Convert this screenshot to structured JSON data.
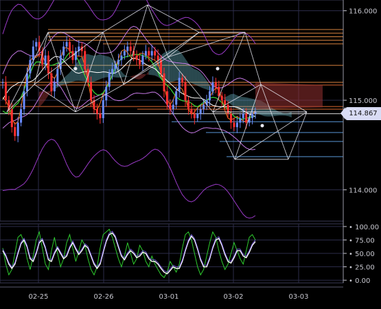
{
  "chart_data": [
    {
      "type": "candlestick",
      "title": "",
      "x_ticks": [
        "02-25",
        "02-26",
        "03-01",
        "03-02",
        "03-03"
      ],
      "y_ticks": [
        "116.000",
        "115.000",
        "114.000"
      ],
      "ylim": [
        113.65,
        116.12
      ],
      "current_price": "114.867",
      "grid": true,
      "overlays": [
        "bollinger-bands",
        "ichimoku-cloud",
        "moving-averages",
        "horizontal-levels",
        "geometric-pattern"
      ],
      "horizontal_levels": [
        115.79,
        115.75,
        115.71,
        115.67,
        115.63,
        115.39,
        115.2,
        115.17,
        114.93,
        114.9,
        114.85,
        114.76,
        114.64,
        114.54,
        114.37
      ],
      "close_series": [
        115.2,
        115.0,
        114.9,
        114.7,
        114.6,
        114.75,
        114.9,
        115.1,
        115.3,
        115.45,
        115.6,
        115.65,
        115.55,
        115.4,
        115.5,
        115.3,
        115.1,
        115.2,
        115.35,
        115.5,
        115.6,
        115.65,
        115.55,
        115.45,
        115.55,
        115.6,
        115.55,
        115.35,
        115.2,
        115.0,
        114.9,
        114.85,
        114.8,
        115.0,
        115.15,
        115.3,
        115.35,
        115.4,
        115.45,
        115.5,
        115.55,
        115.6,
        115.55,
        115.5,
        115.45,
        115.4,
        115.5,
        115.55,
        115.5,
        115.55,
        115.5,
        115.45,
        115.3,
        115.1,
        114.95,
        114.9,
        114.95,
        115.1,
        115.25,
        115.2,
        115.0,
        114.9,
        114.85,
        114.8,
        114.85,
        114.9,
        114.95,
        115.0,
        115.1,
        115.2,
        115.15,
        115.05,
        115.0,
        114.95,
        114.85,
        114.75,
        114.7,
        114.75,
        114.8,
        114.85,
        114.75,
        114.8,
        114.85,
        114.87
      ]
    },
    {
      "type": "line",
      "title": "",
      "y_ticks": [
        "100.00",
        "75.00",
        "50.00",
        "25.00",
        "0.00"
      ],
      "ylim": [
        -5,
        105
      ],
      "grid": true,
      "series": [
        {
          "values": [
            60,
            30,
            10,
            20,
            50,
            80,
            85,
            70,
            40,
            20,
            45,
            75,
            90,
            60,
            30,
            20,
            55,
            80,
            50,
            25,
            40,
            70,
            85,
            60,
            35,
            55,
            75,
            65,
            40,
            20,
            10,
            25,
            60,
            85,
            90,
            95,
            80,
            60,
            40,
            25,
            45,
            70,
            50,
            30,
            40,
            65,
            55,
            35,
            25,
            45,
            30,
            20,
            10,
            5,
            15,
            35,
            25,
            15,
            30,
            60,
            85,
            90,
            75,
            50,
            25,
            10,
            20,
            45,
            70,
            90,
            80,
            55,
            35,
            20,
            30,
            50,
            70,
            55,
            40,
            30,
            55,
            80,
            85,
            75
          ]
        },
        {
          "values": [
            55,
            45,
            30,
            22,
            30,
            50,
            68,
            75,
            62,
            40,
            35,
            50,
            70,
            75,
            60,
            38,
            35,
            50,
            60,
            50,
            40,
            45,
            60,
            70,
            58,
            48,
            55,
            65,
            60,
            45,
            30,
            22,
            30,
            52,
            72,
            85,
            88,
            80,
            62,
            45,
            38,
            48,
            55,
            50,
            42,
            45,
            52,
            50,
            40,
            35,
            35,
            30,
            22,
            15,
            12,
            18,
            25,
            22,
            22,
            35,
            55,
            72,
            82,
            75,
            58,
            38,
            25,
            25,
            40,
            60,
            75,
            78,
            65,
            48,
            35,
            32,
            42,
            55,
            55,
            45,
            42,
            52,
            65,
            72
          ]
        }
      ]
    }
  ]
}
